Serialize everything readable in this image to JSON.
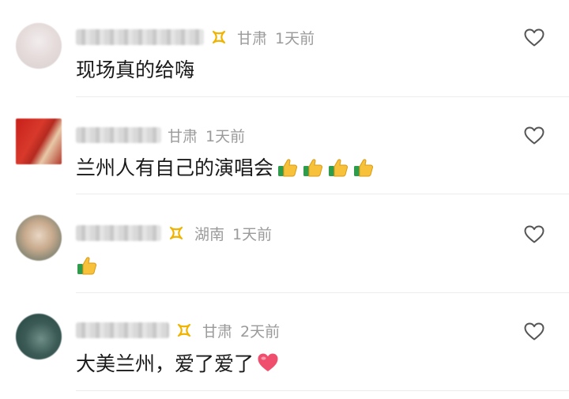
{
  "comments": [
    {
      "location": "甘肃",
      "time": "1天前",
      "text": "现场真的给嗨",
      "has_badge": true,
      "emojis": []
    },
    {
      "location": "甘肃",
      "time": "1天前",
      "text": "兰州人有自己的演唱会",
      "has_badge": false,
      "emojis": [
        "thumbs-up",
        "thumbs-up",
        "thumbs-up",
        "thumbs-up"
      ]
    },
    {
      "location": "湖南",
      "time": "1天前",
      "text": "",
      "has_badge": true,
      "emojis": [
        "thumbs-up"
      ]
    },
    {
      "location": "甘肃",
      "time": "2天前",
      "text": "大美兰州，爱了爱了",
      "has_badge": true,
      "emojis": [
        "red-heart"
      ]
    }
  ],
  "colors": {
    "meta_text": "#9a9a9a",
    "body_text": "#1a1a1a",
    "badge": "#f0b400",
    "heart_outline": "#555555",
    "divider": "#ececec"
  }
}
